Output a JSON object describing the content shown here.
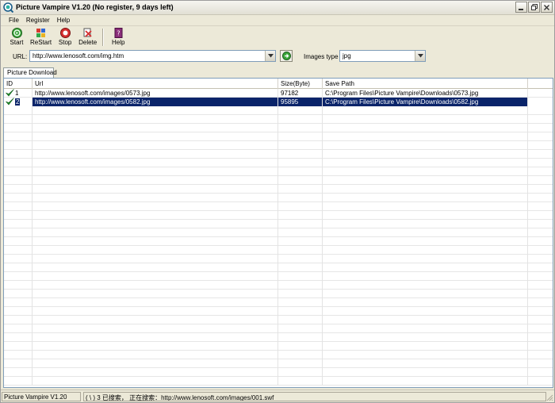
{
  "window": {
    "title": "Picture Vampire V1.20 (No register, 9 days left)"
  },
  "menu": [
    {
      "label": "File",
      "name": "menu-file"
    },
    {
      "label": "Register",
      "name": "menu-register"
    },
    {
      "label": "Help",
      "name": "menu-help"
    }
  ],
  "toolbar": {
    "start": "Start",
    "restart": "ReStart",
    "stop": "Stop",
    "delete": "Delete",
    "help": "Help"
  },
  "url": {
    "label": "URL:",
    "value": "http://www.lenosoft.com/img.htm"
  },
  "images_type": {
    "label": "Images type",
    "value": "jpg"
  },
  "tab": {
    "label": "Picture Download"
  },
  "table": {
    "columns": [
      "ID",
      "Url",
      "Size(Byte)",
      "Save Path"
    ],
    "rows": [
      {
        "id": "1",
        "url": "http://www.lenosoft.com/images/0573.jpg",
        "size": "97182",
        "path": "C:\\Program Files\\Picture Vampire\\Downloads\\0573.jpg",
        "selected": false
      },
      {
        "id": "2",
        "url": "http://www.lenosoft.com/images/0582.jpg",
        "size": "95895",
        "path": "C:\\Program Files\\Picture Vampire\\Downloads\\0582.jpg",
        "selected": true
      }
    ]
  },
  "status": {
    "app": "Picture Vampire V1.20",
    "message": "( \\ ) 3 已搜索，  正在搜索：http://www.lenosoft.com/images/001.swf"
  },
  "colors": {
    "selection": "#0a246a",
    "check": "#1f9a2b",
    "window_bg": "#ece9d8"
  }
}
